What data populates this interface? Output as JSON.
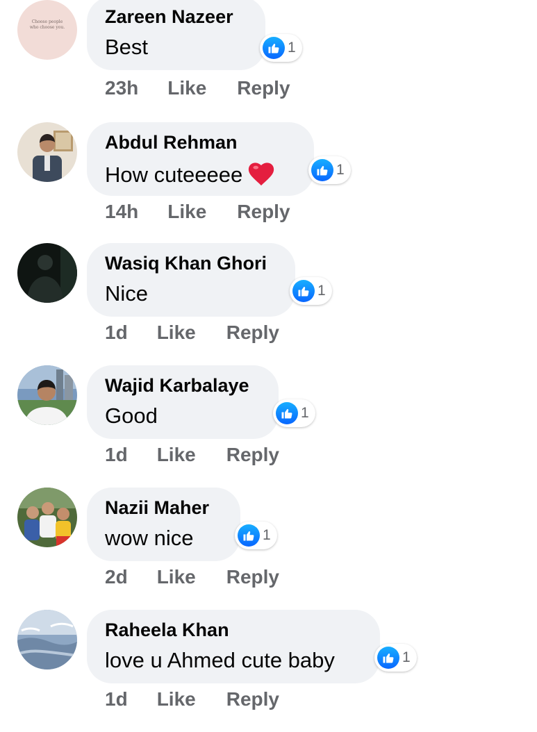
{
  "colors": {
    "bubble": "#f0f2f5",
    "meta_text": "#65676b",
    "like_blue": "#0866ff",
    "heart_red": "#e41e3f"
  },
  "comments": [
    {
      "author": "Zareen Nazeer",
      "text": "Best",
      "time": "23h",
      "like_label": "Like",
      "reply_label": "Reply",
      "reaction_count": "1",
      "reaction_icon": "like-thumbs-up-icon",
      "avatar_text": [
        "Choose people",
        "who choose you."
      ]
    },
    {
      "author": "Abdul Rehman",
      "text": "How cuteeeee",
      "emoji": "red-heart-icon",
      "time": "14h",
      "like_label": "Like",
      "reply_label": "Reply",
      "reaction_count": "1",
      "reaction_icon": "like-thumbs-up-icon"
    },
    {
      "author": "Wasiq Khan Ghori",
      "text": "Nice",
      "time": "1d",
      "like_label": "Like",
      "reply_label": "Reply",
      "reaction_count": "1",
      "reaction_icon": "like-thumbs-up-icon"
    },
    {
      "author": "Wajid Karbalaye",
      "text": "Good",
      "time": "1d",
      "like_label": "Like",
      "reply_label": "Reply",
      "reaction_count": "1",
      "reaction_icon": "like-thumbs-up-icon"
    },
    {
      "author": "Nazii Maher",
      "text": "wow nice",
      "time": "2d",
      "like_label": "Like",
      "reply_label": "Reply",
      "reaction_count": "1",
      "reaction_icon": "like-thumbs-up-icon"
    },
    {
      "author": "Raheela Khan",
      "text": "love u Ahmed cute baby",
      "time": "1d",
      "like_label": "Like",
      "reply_label": "Reply",
      "reaction_count": "1",
      "reaction_icon": "like-thumbs-up-icon"
    }
  ]
}
